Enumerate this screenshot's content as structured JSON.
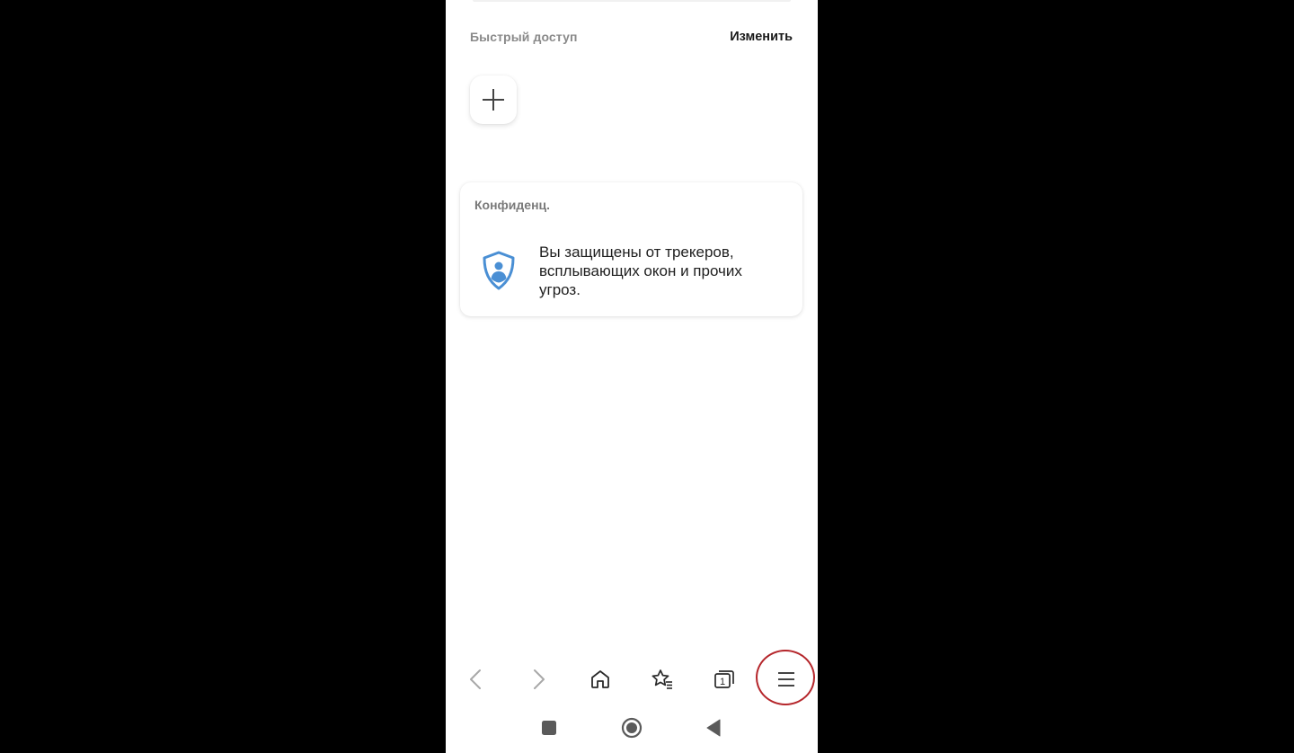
{
  "quick_access": {
    "title": "Быстрый доступ",
    "edit_label": "Изменить",
    "add_icon": "plus-icon"
  },
  "privacy_card": {
    "title": "Конфиденц.",
    "message": "Вы защищены от трекеров, всплывающих окон и прочих угроз.",
    "icon": "shield-user-icon",
    "icon_color": "#4a8fd4"
  },
  "toolbar": {
    "items": [
      "back-icon",
      "forward-icon",
      "home-icon",
      "bookmarks-icon",
      "tabs-icon",
      "menu-icon"
    ],
    "tab_count": "1",
    "highlight_color": "#b5262b"
  },
  "system_nav": {
    "items": [
      "recents-icon",
      "home-circle-icon",
      "back-triangle-icon"
    ]
  },
  "colors": {
    "background": "#000000",
    "screen": "#ffffff",
    "icon": "#2a2a2a",
    "icon_disabled": "#a8a8a8"
  }
}
